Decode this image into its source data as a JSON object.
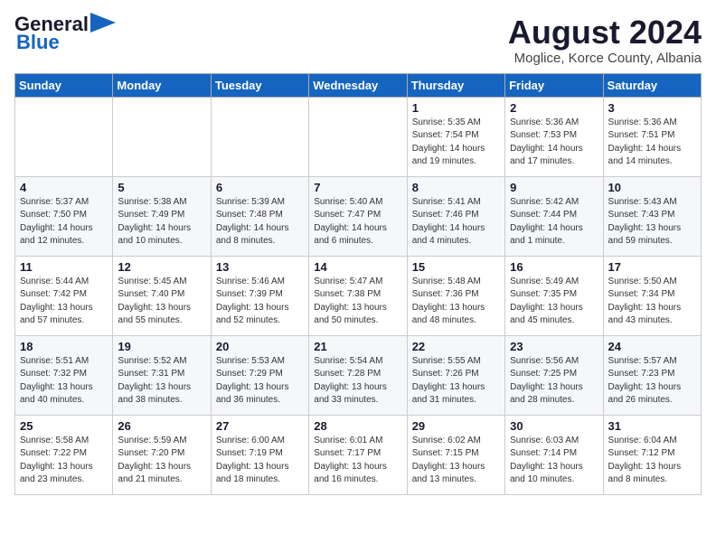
{
  "header": {
    "logo_line1": "General",
    "logo_line2": "Blue",
    "month": "August 2024",
    "location": "Moglice, Korce County, Albania"
  },
  "weekdays": [
    "Sunday",
    "Monday",
    "Tuesday",
    "Wednesday",
    "Thursday",
    "Friday",
    "Saturday"
  ],
  "weeks": [
    [
      {
        "day": "",
        "info": ""
      },
      {
        "day": "",
        "info": ""
      },
      {
        "day": "",
        "info": ""
      },
      {
        "day": "",
        "info": ""
      },
      {
        "day": "1",
        "info": "Sunrise: 5:35 AM\nSunset: 7:54 PM\nDaylight: 14 hours\nand 19 minutes."
      },
      {
        "day": "2",
        "info": "Sunrise: 5:36 AM\nSunset: 7:53 PM\nDaylight: 14 hours\nand 17 minutes."
      },
      {
        "day": "3",
        "info": "Sunrise: 5:36 AM\nSunset: 7:51 PM\nDaylight: 14 hours\nand 14 minutes."
      }
    ],
    [
      {
        "day": "4",
        "info": "Sunrise: 5:37 AM\nSunset: 7:50 PM\nDaylight: 14 hours\nand 12 minutes."
      },
      {
        "day": "5",
        "info": "Sunrise: 5:38 AM\nSunset: 7:49 PM\nDaylight: 14 hours\nand 10 minutes."
      },
      {
        "day": "6",
        "info": "Sunrise: 5:39 AM\nSunset: 7:48 PM\nDaylight: 14 hours\nand 8 minutes."
      },
      {
        "day": "7",
        "info": "Sunrise: 5:40 AM\nSunset: 7:47 PM\nDaylight: 14 hours\nand 6 minutes."
      },
      {
        "day": "8",
        "info": "Sunrise: 5:41 AM\nSunset: 7:46 PM\nDaylight: 14 hours\nand 4 minutes."
      },
      {
        "day": "9",
        "info": "Sunrise: 5:42 AM\nSunset: 7:44 PM\nDaylight: 14 hours\nand 1 minute."
      },
      {
        "day": "10",
        "info": "Sunrise: 5:43 AM\nSunset: 7:43 PM\nDaylight: 13 hours\nand 59 minutes."
      }
    ],
    [
      {
        "day": "11",
        "info": "Sunrise: 5:44 AM\nSunset: 7:42 PM\nDaylight: 13 hours\nand 57 minutes."
      },
      {
        "day": "12",
        "info": "Sunrise: 5:45 AM\nSunset: 7:40 PM\nDaylight: 13 hours\nand 55 minutes."
      },
      {
        "day": "13",
        "info": "Sunrise: 5:46 AM\nSunset: 7:39 PM\nDaylight: 13 hours\nand 52 minutes."
      },
      {
        "day": "14",
        "info": "Sunrise: 5:47 AM\nSunset: 7:38 PM\nDaylight: 13 hours\nand 50 minutes."
      },
      {
        "day": "15",
        "info": "Sunrise: 5:48 AM\nSunset: 7:36 PM\nDaylight: 13 hours\nand 48 minutes."
      },
      {
        "day": "16",
        "info": "Sunrise: 5:49 AM\nSunset: 7:35 PM\nDaylight: 13 hours\nand 45 minutes."
      },
      {
        "day": "17",
        "info": "Sunrise: 5:50 AM\nSunset: 7:34 PM\nDaylight: 13 hours\nand 43 minutes."
      }
    ],
    [
      {
        "day": "18",
        "info": "Sunrise: 5:51 AM\nSunset: 7:32 PM\nDaylight: 13 hours\nand 40 minutes."
      },
      {
        "day": "19",
        "info": "Sunrise: 5:52 AM\nSunset: 7:31 PM\nDaylight: 13 hours\nand 38 minutes."
      },
      {
        "day": "20",
        "info": "Sunrise: 5:53 AM\nSunset: 7:29 PM\nDaylight: 13 hours\nand 36 minutes."
      },
      {
        "day": "21",
        "info": "Sunrise: 5:54 AM\nSunset: 7:28 PM\nDaylight: 13 hours\nand 33 minutes."
      },
      {
        "day": "22",
        "info": "Sunrise: 5:55 AM\nSunset: 7:26 PM\nDaylight: 13 hours\nand 31 minutes."
      },
      {
        "day": "23",
        "info": "Sunrise: 5:56 AM\nSunset: 7:25 PM\nDaylight: 13 hours\nand 28 minutes."
      },
      {
        "day": "24",
        "info": "Sunrise: 5:57 AM\nSunset: 7:23 PM\nDaylight: 13 hours\nand 26 minutes."
      }
    ],
    [
      {
        "day": "25",
        "info": "Sunrise: 5:58 AM\nSunset: 7:22 PM\nDaylight: 13 hours\nand 23 minutes."
      },
      {
        "day": "26",
        "info": "Sunrise: 5:59 AM\nSunset: 7:20 PM\nDaylight: 13 hours\nand 21 minutes."
      },
      {
        "day": "27",
        "info": "Sunrise: 6:00 AM\nSunset: 7:19 PM\nDaylight: 13 hours\nand 18 minutes."
      },
      {
        "day": "28",
        "info": "Sunrise: 6:01 AM\nSunset: 7:17 PM\nDaylight: 13 hours\nand 16 minutes."
      },
      {
        "day": "29",
        "info": "Sunrise: 6:02 AM\nSunset: 7:15 PM\nDaylight: 13 hours\nand 13 minutes."
      },
      {
        "day": "30",
        "info": "Sunrise: 6:03 AM\nSunset: 7:14 PM\nDaylight: 13 hours\nand 10 minutes."
      },
      {
        "day": "31",
        "info": "Sunrise: 6:04 AM\nSunset: 7:12 PM\nDaylight: 13 hours\nand 8 minutes."
      }
    ]
  ]
}
